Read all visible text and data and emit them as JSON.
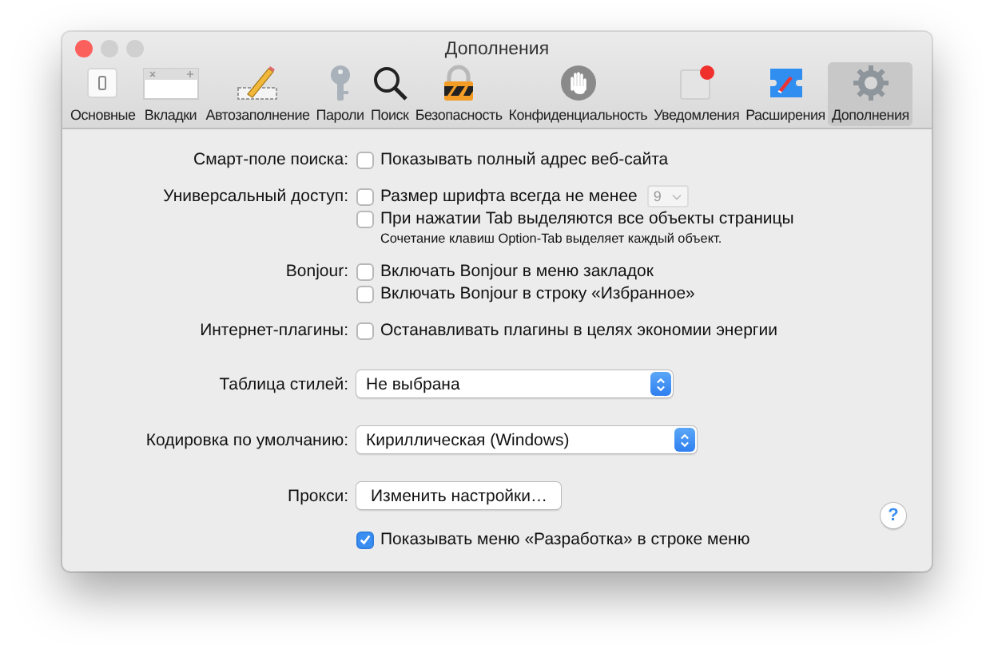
{
  "window": {
    "title": "Дополнения",
    "traffic_lights": [
      {
        "color": "#fc605c"
      },
      {
        "color": "#d0d0d0"
      },
      {
        "color": "#d0d0d0"
      }
    ]
  },
  "toolbar": [
    {
      "kind": "general",
      "label": "Основные",
      "selected": false
    },
    {
      "kind": "tabs",
      "label": "Вкладки",
      "selected": false
    },
    {
      "kind": "autofill",
      "label": "Автозаполнение",
      "selected": false
    },
    {
      "kind": "passwords",
      "label": "Пароли",
      "selected": false
    },
    {
      "kind": "search",
      "label": "Поиск",
      "selected": false
    },
    {
      "kind": "security",
      "label": "Безопасность",
      "selected": false
    },
    {
      "kind": "privacy",
      "label": "Конфиденциальность",
      "selected": false
    },
    {
      "kind": "notifications",
      "label": "Уведомления",
      "selected": false
    },
    {
      "kind": "extensions",
      "label": "Расширения",
      "selected": false
    },
    {
      "kind": "advanced",
      "label": "Дополнения",
      "selected": true
    }
  ],
  "settings": [
    {
      "kind": "checks",
      "label": "Смарт-поле поиска:",
      "options": [
        {
          "text": "Показывать полный адрес веб-сайта",
          "checked": false
        }
      ]
    },
    {
      "kind": "checks",
      "label": "Универсальный доступ:",
      "options": [
        {
          "text": "Размер шрифта всегда не менее",
          "checked": false,
          "select": {
            "value": "9",
            "disabled": true
          }
        },
        {
          "text": "При нажатии Tab выделяются все объекты страницы",
          "checked": false
        }
      ],
      "note": "Сочетание клавиш Option-Tab выделяет каждый объект."
    },
    {
      "kind": "checks",
      "label": "Bonjour:",
      "options": [
        {
          "text": "Включать Bonjour в меню закладок",
          "checked": false
        },
        {
          "text": "Включать Bonjour в строку «Избранное»",
          "checked": false
        }
      ]
    },
    {
      "kind": "checks",
      "label": "Интернет-плагины:",
      "options": [
        {
          "text": "Останавливать плагины в целях экономии энергии",
          "checked": false
        }
      ]
    },
    {
      "kind": "popup",
      "label": "Таблица стилей:",
      "value": "Не выбрана"
    },
    {
      "kind": "popup",
      "label": "Кодировка по умолчанию:",
      "value": "Кириллическая (Windows)"
    },
    {
      "kind": "button",
      "label": "Прокси:",
      "button": "Изменить настройки…"
    },
    {
      "kind": "checks",
      "options": [
        {
          "text": "Показывать меню «Разработка» в строке меню",
          "checked": true
        }
      ]
    }
  ],
  "help": "?"
}
